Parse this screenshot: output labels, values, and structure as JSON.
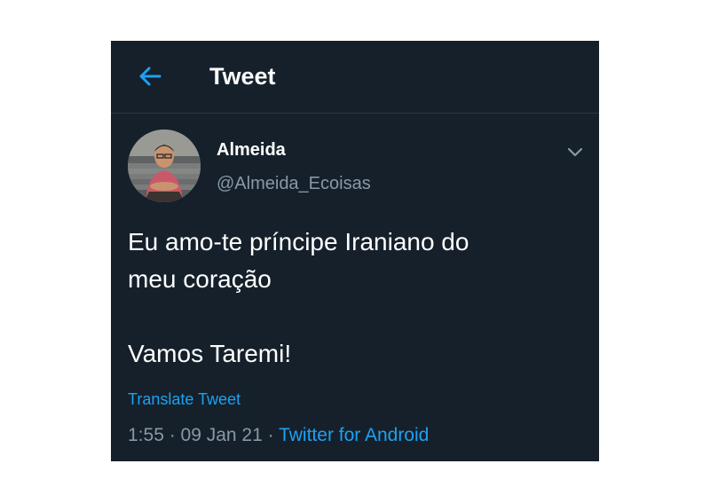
{
  "header": {
    "title": "Tweet",
    "back_icon": "arrow-left-icon",
    "accent_color": "#1da1f2"
  },
  "tweet": {
    "author": {
      "display_name": "Almeida",
      "handle": "@Almeida_Ecoisas"
    },
    "body_lines": [
      "Eu amo-te príncipe Iraniano do",
      "meu coração",
      "Vamos Taremi!"
    ],
    "translate_label": "Translate Tweet",
    "time": "1:55",
    "separator": " · ",
    "date": "09 Jan 21",
    "source": "Twitter for Android",
    "menu_icon": "chevron-down-icon"
  },
  "colors": {
    "background": "#15202b",
    "secondary_text": "#8899a6",
    "link": "#1da1f2"
  }
}
